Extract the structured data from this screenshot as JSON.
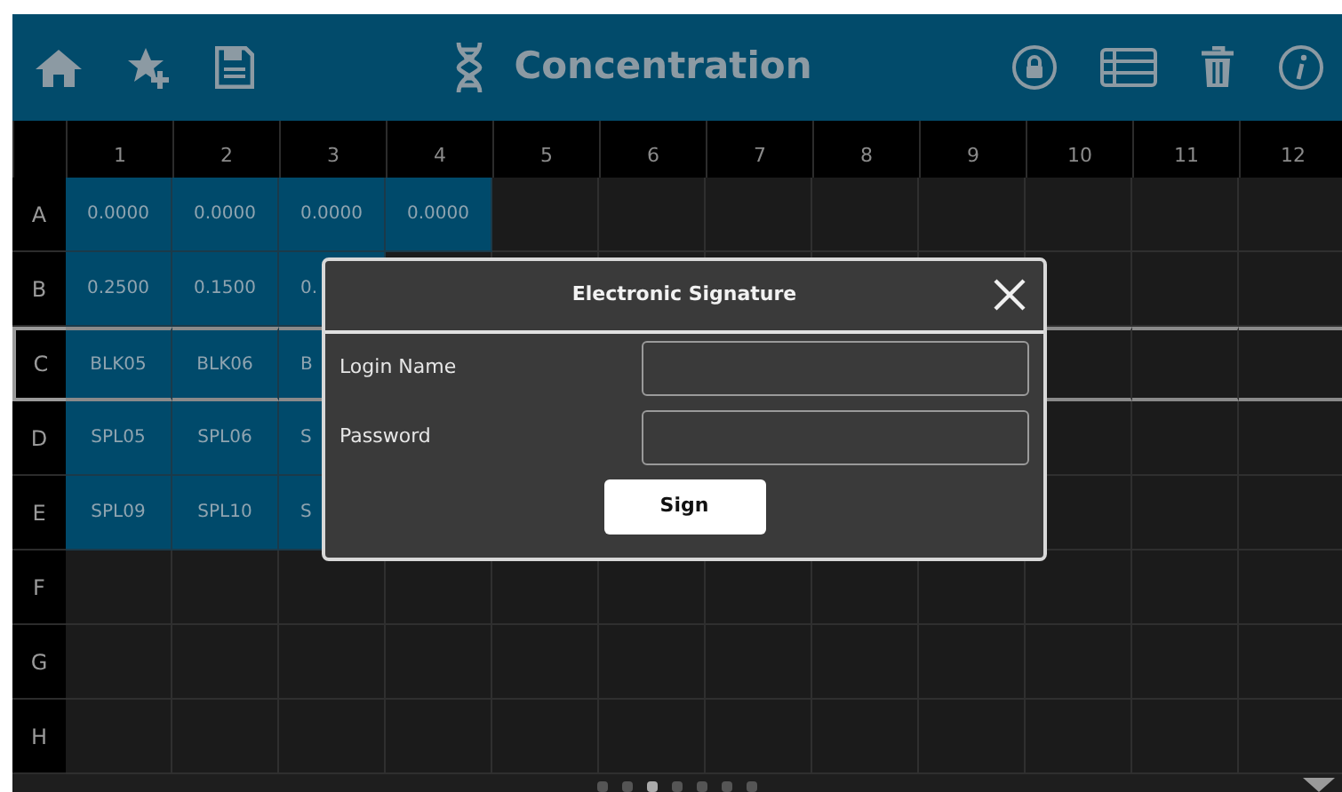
{
  "header": {
    "title": "Concentration"
  },
  "columns": [
    "1",
    "2",
    "3",
    "4",
    "5",
    "6",
    "7",
    "8",
    "9",
    "10",
    "11",
    "12"
  ],
  "rows": [
    {
      "label": "A",
      "selected": false,
      "cells": [
        {
          "text": "0.0000",
          "filled": true
        },
        {
          "text": "0.0000",
          "filled": true
        },
        {
          "text": "0.0000",
          "filled": true
        },
        {
          "text": "0.0000",
          "filled": true
        }
      ]
    },
    {
      "label": "B",
      "selected": false,
      "cells": [
        {
          "text": "0.2500",
          "filled": true
        },
        {
          "text": "0.1500",
          "filled": true
        },
        {
          "text": "0.",
          "filled": true,
          "partial": true
        }
      ]
    },
    {
      "label": "C",
      "selected": true,
      "cells": [
        {
          "text": "BLK05",
          "filled": true
        },
        {
          "text": "BLK06",
          "filled": true
        },
        {
          "text": "B",
          "filled": true,
          "partial": true
        }
      ]
    },
    {
      "label": "D",
      "selected": false,
      "cells": [
        {
          "text": "SPL05",
          "filled": true
        },
        {
          "text": "SPL06",
          "filled": true
        },
        {
          "text": "S",
          "filled": true,
          "partial": true
        }
      ]
    },
    {
      "label": "E",
      "selected": false,
      "cells": [
        {
          "text": "SPL09",
          "filled": true
        },
        {
          "text": "SPL10",
          "filled": true
        },
        {
          "text": "S",
          "filled": true,
          "partial": true
        }
      ]
    },
    {
      "label": "F",
      "selected": false,
      "cells": []
    },
    {
      "label": "G",
      "selected": false,
      "cells": []
    },
    {
      "label": "H",
      "selected": false,
      "cells": []
    }
  ],
  "dialog": {
    "title": "Electronic Signature",
    "fields": [
      {
        "label": "Login Name"
      },
      {
        "label": "Password"
      }
    ],
    "button": "Sign"
  },
  "pages": [
    {
      "selected": false
    },
    {
      "selected": false
    },
    {
      "selected": true
    },
    {
      "selected": false
    },
    {
      "selected": false
    },
    {
      "selected": false
    },
    {
      "selected": false
    }
  ]
}
